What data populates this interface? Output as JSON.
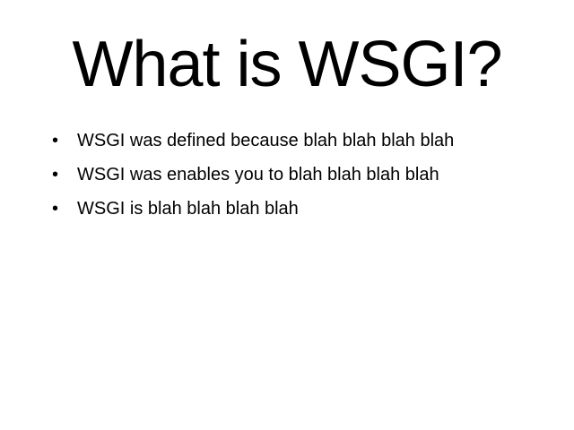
{
  "slide": {
    "title": "What is WSGI?",
    "bullets": [
      "WSGI was defined because blah blah blah blah",
      "WSGI was enables you to blah blah blah blah",
      "WSGI is blah blah blah blah"
    ],
    "bullet_glyph": "•"
  }
}
